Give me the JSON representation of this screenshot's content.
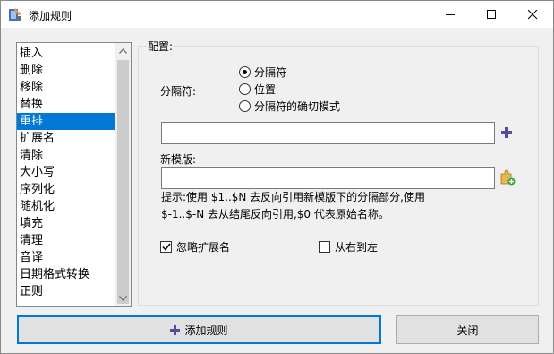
{
  "window": {
    "title": "添加规则"
  },
  "rules": {
    "items": [
      "插入",
      "删除",
      "移除",
      "替换",
      "重排",
      "扩展名",
      "清除",
      "大小写",
      "序列化",
      "随机化",
      "填充",
      "清理",
      "音译",
      "日期格式转换",
      "正则"
    ],
    "selected": "重排"
  },
  "config": {
    "group_label": "配置:",
    "separator_label": "分隔符:",
    "options": [
      "分隔符",
      "位置",
      "分隔符的确切模式"
    ],
    "selected_option": "分隔符",
    "separator_value": "",
    "template_label": "新模版:",
    "template_value": "",
    "hint_line1": "提示:使用 $1..$N 去反向引用新模版下的分隔部分,使用",
    "hint_line2": "$-1..$-N 去从结尾反向引用,$0 代表原始名称。",
    "ignore_ext_label": "忽略扩展名",
    "ignore_ext_checked": true,
    "right_to_left_label": "从右到左",
    "right_to_left_checked": false
  },
  "buttons": {
    "add_rule": "添加规则",
    "close": "关闭"
  },
  "colors": {
    "selection": "#0078d7",
    "plus_icon": "#5a4a9c"
  }
}
